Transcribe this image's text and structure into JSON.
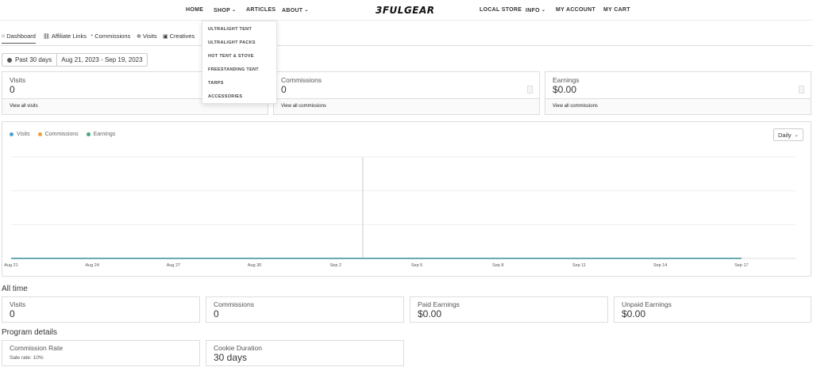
{
  "nav": {
    "home": "HOME",
    "shop": "SHOP",
    "articles": "ARTICLES",
    "about": "ABOUT",
    "logo": "3FULGEAR",
    "local_store": "LOCAL STORE",
    "info": "INFO",
    "my_account": "MY ACCOUNT",
    "my_cart": "MY CART"
  },
  "shop_menu": {
    "items": [
      "ULTRALIGHT TENT",
      "ULTRALIGHT PACKS",
      "HOT TENT & STOVE",
      "FREESTANDING TENT",
      "TARPS",
      "ACCESSORIES"
    ]
  },
  "tabs": {
    "dashboard": "Dashboard",
    "affiliate_links": "Affiliate Links",
    "commissions": "Commissions",
    "visits": "Visits",
    "creatives": "Creatives"
  },
  "date_filter": {
    "range": "Past 30 days",
    "dates": "Aug 21, 2023 - Sep 19, 2023"
  },
  "summary": {
    "visits": {
      "label": "Visits",
      "value": "0",
      "link": "View all visits"
    },
    "commissions": {
      "label": "Commissions",
      "value": "0",
      "link": "View all commissions"
    },
    "earnings": {
      "label": "Earnings",
      "value": "$0.00",
      "link": "View all commissions"
    }
  },
  "chart": {
    "interval": "Daily"
  },
  "chart_data": {
    "type": "line",
    "x": [
      "Aug 21",
      "Aug 24",
      "Aug 27",
      "Aug 30",
      "Sep 2",
      "Sep 5",
      "Sep 8",
      "Sep 11",
      "Sep 14",
      "Sep 17"
    ],
    "series": [
      {
        "name": "Visits",
        "values": [
          0,
          0,
          0,
          0,
          0,
          0,
          0,
          0,
          0,
          0
        ],
        "color": "#4aa3c9"
      },
      {
        "name": "Commissions",
        "values": [
          0,
          0,
          0,
          0,
          0,
          0,
          0,
          0,
          0,
          0
        ],
        "color": "#f0a030"
      },
      {
        "name": "Earnings",
        "values": [
          0,
          0,
          0,
          0,
          0,
          0,
          0,
          0,
          0,
          0
        ],
        "color": "#3aaa78"
      }
    ],
    "ylim": [
      0,
      1
    ],
    "grid": true,
    "legend": "top-left"
  },
  "all_time": {
    "title": "All time",
    "visits": {
      "label": "Visits",
      "value": "0"
    },
    "commissions": {
      "label": "Commissions",
      "value": "0"
    },
    "paid_earnings": {
      "label": "Paid Earnings",
      "value": "$0.00"
    },
    "unpaid_earnings": {
      "label": "Unpaid Earnings",
      "value": "$0.00"
    }
  },
  "program": {
    "title": "Program details",
    "commission_rate": {
      "label": "Commission Rate",
      "sub": "Sale rate: 10%"
    },
    "cookie_duration": {
      "label": "Cookie Duration",
      "value": "30 days"
    }
  }
}
